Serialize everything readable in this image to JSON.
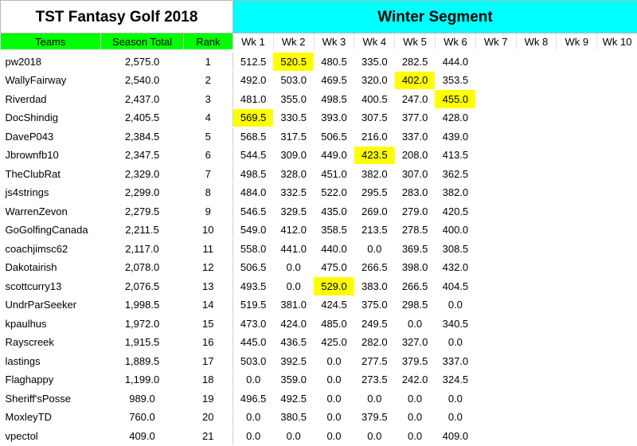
{
  "title_left": "TST Fantasy Golf 2018",
  "title_right": "Winter Segment",
  "headers": {
    "teams": "Teams",
    "season_total": "Season Total",
    "rank": "Rank",
    "weeks": [
      "Wk 1",
      "Wk 2",
      "Wk 3",
      "Wk 4",
      "Wk 5",
      "Wk 6",
      "Wk 7",
      "Wk 8",
      "Wk 9",
      "Wk 10"
    ]
  },
  "colors": {
    "title_right_bg": "#00ffff",
    "header_green": "#00ff00",
    "highlight": "#ffff00"
  },
  "rows": [
    {
      "team": "pw2018",
      "total": "2,575.0",
      "rank": "1",
      "weeks": [
        "512.5",
        "520.5",
        "480.5",
        "335.0",
        "282.5",
        "444.0",
        "",
        "",
        "",
        ""
      ],
      "highlight": [
        1
      ]
    },
    {
      "team": "WallyFairway",
      "total": "2,540.0",
      "rank": "2",
      "weeks": [
        "492.0",
        "503.0",
        "469.5",
        "320.0",
        "402.0",
        "353.5",
        "",
        "",
        "",
        ""
      ],
      "highlight": [
        4
      ]
    },
    {
      "team": "Riverdad",
      "total": "2,437.0",
      "rank": "3",
      "weeks": [
        "481.0",
        "355.0",
        "498.5",
        "400.5",
        "247.0",
        "455.0",
        "",
        "",
        "",
        ""
      ],
      "highlight": [
        5
      ]
    },
    {
      "team": "DocShindig",
      "total": "2,405.5",
      "rank": "4",
      "weeks": [
        "569.5",
        "330.5",
        "393.0",
        "307.5",
        "377.0",
        "428.0",
        "",
        "",
        "",
        ""
      ],
      "highlight": [
        0
      ]
    },
    {
      "team": "DaveP043",
      "total": "2,384.5",
      "rank": "5",
      "weeks": [
        "568.5",
        "317.5",
        "506.5",
        "216.0",
        "337.0",
        "439.0",
        "",
        "",
        "",
        ""
      ],
      "highlight": []
    },
    {
      "team": "Jbrownfb10",
      "total": "2,347.5",
      "rank": "6",
      "weeks": [
        "544.5",
        "309.0",
        "449.0",
        "423.5",
        "208.0",
        "413.5",
        "",
        "",
        "",
        ""
      ],
      "highlight": [
        3
      ]
    },
    {
      "team": "TheClubRat",
      "total": "2,329.0",
      "rank": "7",
      "weeks": [
        "498.5",
        "328.0",
        "451.0",
        "382.0",
        "307.0",
        "362.5",
        "",
        "",
        "",
        ""
      ],
      "highlight": []
    },
    {
      "team": "js4strings",
      "total": "2,299.0",
      "rank": "8",
      "weeks": [
        "484.0",
        "332.5",
        "522.0",
        "295.5",
        "283.0",
        "382.0",
        "",
        "",
        "",
        ""
      ],
      "highlight": []
    },
    {
      "team": "WarrenZevon",
      "total": "2,279.5",
      "rank": "9",
      "weeks": [
        "546.5",
        "329.5",
        "435.0",
        "269.0",
        "279.0",
        "420.5",
        "",
        "",
        "",
        ""
      ],
      "highlight": []
    },
    {
      "team": "GoGolfingCanada",
      "total": "2,211.5",
      "rank": "10",
      "weeks": [
        "549.0",
        "412.0",
        "358.5",
        "213.5",
        "278.5",
        "400.0",
        "",
        "",
        "",
        ""
      ],
      "highlight": []
    },
    {
      "team": "coachjimsc62",
      "total": "2,117.0",
      "rank": "11",
      "weeks": [
        "558.0",
        "441.0",
        "440.0",
        "0.0",
        "369.5",
        "308.5",
        "",
        "",
        "",
        ""
      ],
      "highlight": []
    },
    {
      "team": "Dakotairish",
      "total": "2,078.0",
      "rank": "12",
      "weeks": [
        "506.5",
        "0.0",
        "475.0",
        "266.5",
        "398.0",
        "432.0",
        "",
        "",
        "",
        ""
      ],
      "highlight": []
    },
    {
      "team": "scottcurry13",
      "total": "2,076.5",
      "rank": "13",
      "weeks": [
        "493.5",
        "0.0",
        "529.0",
        "383.0",
        "266.5",
        "404.5",
        "",
        "",
        "",
        ""
      ],
      "highlight": [
        2
      ]
    },
    {
      "team": "UndrParSeeker",
      "total": "1,998.5",
      "rank": "14",
      "weeks": [
        "519.5",
        "381.0",
        "424.5",
        "375.0",
        "298.5",
        "0.0",
        "",
        "",
        "",
        ""
      ],
      "highlight": []
    },
    {
      "team": "kpaulhus",
      "total": "1,972.0",
      "rank": "15",
      "weeks": [
        "473.0",
        "424.0",
        "485.0",
        "249.5",
        "0.0",
        "340.5",
        "",
        "",
        "",
        ""
      ],
      "highlight": []
    },
    {
      "team": "Rayscreek",
      "total": "1,915.5",
      "rank": "16",
      "weeks": [
        "445.0",
        "436.5",
        "425.0",
        "282.0",
        "327.0",
        "0.0",
        "",
        "",
        "",
        ""
      ],
      "highlight": []
    },
    {
      "team": "lastings",
      "total": "1,889.5",
      "rank": "17",
      "weeks": [
        "503.0",
        "392.5",
        "0.0",
        "277.5",
        "379.5",
        "337.0",
        "",
        "",
        "",
        ""
      ],
      "highlight": []
    },
    {
      "team": "Flaghappy",
      "total": "1,199.0",
      "rank": "18",
      "weeks": [
        "0.0",
        "359.0",
        "0.0",
        "273.5",
        "242.0",
        "324.5",
        "",
        "",
        "",
        ""
      ],
      "highlight": []
    },
    {
      "team": "Sheriff'sPosse",
      "total": "989.0",
      "rank": "19",
      "weeks": [
        "496.5",
        "492.5",
        "0.0",
        "0.0",
        "0.0",
        "0.0",
        "",
        "",
        "",
        ""
      ],
      "highlight": []
    },
    {
      "team": "MoxleyTD",
      "total": "760.0",
      "rank": "20",
      "weeks": [
        "0.0",
        "380.5",
        "0.0",
        "379.5",
        "0.0",
        "0.0",
        "",
        "",
        "",
        ""
      ],
      "highlight": []
    },
    {
      "team": "vpectol",
      "total": "409.0",
      "rank": "21",
      "weeks": [
        "0.0",
        "0.0",
        "0.0",
        "0.0",
        "0.0",
        "409.0",
        "",
        "",
        "",
        ""
      ],
      "highlight": []
    }
  ]
}
